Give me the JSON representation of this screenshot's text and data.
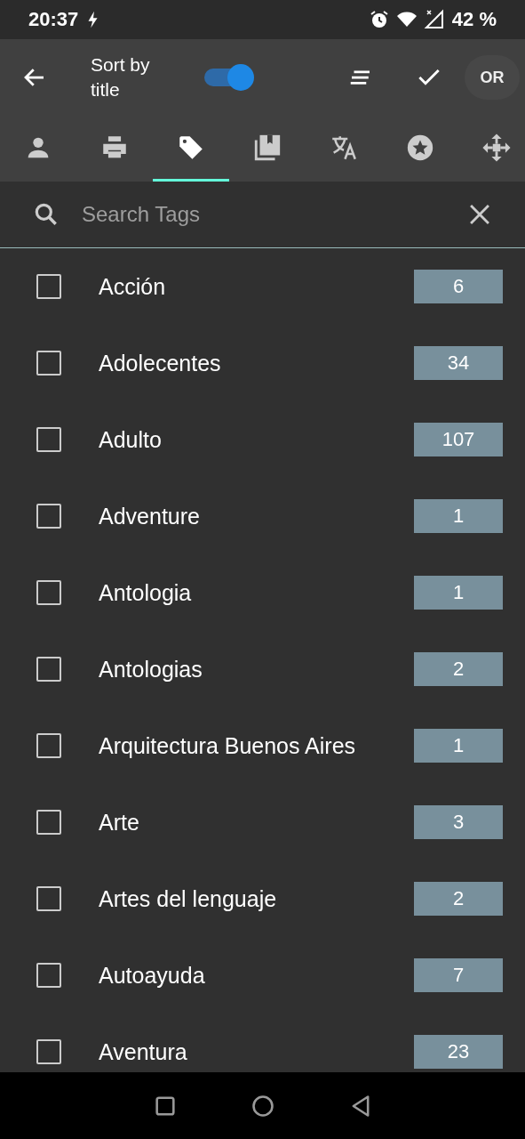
{
  "status_bar": {
    "time": "20:37",
    "battery": "42 %"
  },
  "toolbar": {
    "title": "Sort by title",
    "sort_toggle": {
      "on": true
    },
    "mode_button": "OR"
  },
  "tabs": [
    {
      "kind": "person",
      "selected": false
    },
    {
      "kind": "printer",
      "selected": false
    },
    {
      "kind": "tag",
      "selected": true
    },
    {
      "kind": "library",
      "selected": false
    },
    {
      "kind": "translate",
      "selected": false
    },
    {
      "kind": "star",
      "selected": false
    },
    {
      "kind": "move",
      "selected": false
    }
  ],
  "search": {
    "placeholder": "Search Tags"
  },
  "tags": [
    {
      "label": "Acción",
      "count": "6",
      "checked": false
    },
    {
      "label": "Adolecentes",
      "count": "34",
      "checked": false
    },
    {
      "label": "Adulto",
      "count": "107",
      "checked": false
    },
    {
      "label": "Adventure",
      "count": "1",
      "checked": false
    },
    {
      "label": "Antologia",
      "count": "1",
      "checked": false
    },
    {
      "label": "Antologias",
      "count": "2",
      "checked": false
    },
    {
      "label": "Arquitectura Buenos Aires",
      "count": "1",
      "checked": false
    },
    {
      "label": "Arte",
      "count": "3",
      "checked": false
    },
    {
      "label": "Artes del lenguaje",
      "count": "2",
      "checked": false
    },
    {
      "label": "Autoayuda",
      "count": "7",
      "checked": false
    },
    {
      "label": "Aventura",
      "count": "23",
      "checked": false
    }
  ]
}
